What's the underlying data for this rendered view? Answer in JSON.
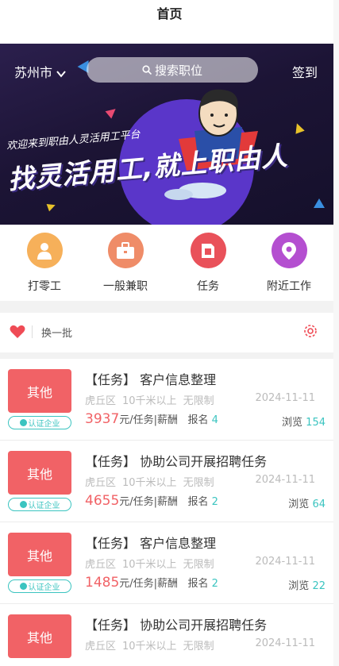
{
  "header": {
    "title": "首页"
  },
  "banner": {
    "city": "苏州市",
    "search_placeholder": "搜索职位",
    "checkin": "签到",
    "welcome": "欢迎来到职由人灵活用工平台",
    "slogan": "找灵活用工,就上职由人"
  },
  "categories": [
    {
      "label": "打零工",
      "color": "#f6b05a",
      "icon": "worker-icon"
    },
    {
      "label": "一般兼职",
      "color": "#ef8c68",
      "icon": "briefcase-icon"
    },
    {
      "label": "任务",
      "color": "#e9515a",
      "icon": "document-icon"
    },
    {
      "label": "附近工作",
      "color": "#b44fd0",
      "icon": "location-pin-icon"
    }
  ],
  "toolbar": {
    "refresh": "换一批"
  },
  "jobs": [
    {
      "tag": "其他",
      "cert": "认证企业",
      "title": "【任务】 客户信息整理",
      "district": "虎丘区",
      "distance": "10千米以上",
      "limit": "无限制",
      "date": "2024-11-11",
      "price": "3937",
      "unit": "元/任务",
      "pay": "薪酬",
      "signup_label": "报名",
      "signup": "4",
      "views_label": "浏览",
      "views": "154"
    },
    {
      "tag": "其他",
      "cert": "认证企业",
      "title": "【任务】 协助公司开展招聘任务",
      "district": "虎丘区",
      "distance": "10千米以上",
      "limit": "无限制",
      "date": "2024-11-11",
      "price": "4655",
      "unit": "元/任务",
      "pay": "薪酬",
      "signup_label": "报名",
      "signup": "2",
      "views_label": "浏览",
      "views": "64"
    },
    {
      "tag": "其他",
      "cert": "认证企业",
      "title": "【任务】 客户信息整理",
      "district": "虎丘区",
      "distance": "10千米以上",
      "limit": "无限制",
      "date": "2024-11-11",
      "price": "1485",
      "unit": "元/任务",
      "pay": "薪酬",
      "signup_label": "报名",
      "signup": "2",
      "views_label": "浏览",
      "views": "22"
    },
    {
      "tag": "其他",
      "cert": "认证企业",
      "title": "【任务】 协助公司开展招聘任务",
      "district": "虎丘区",
      "distance": "10千米以上",
      "limit": "无限制",
      "date": "2024-11-11",
      "price": "",
      "unit": "",
      "pay": "",
      "signup_label": "",
      "signup": "",
      "views_label": "",
      "views": ""
    }
  ]
}
